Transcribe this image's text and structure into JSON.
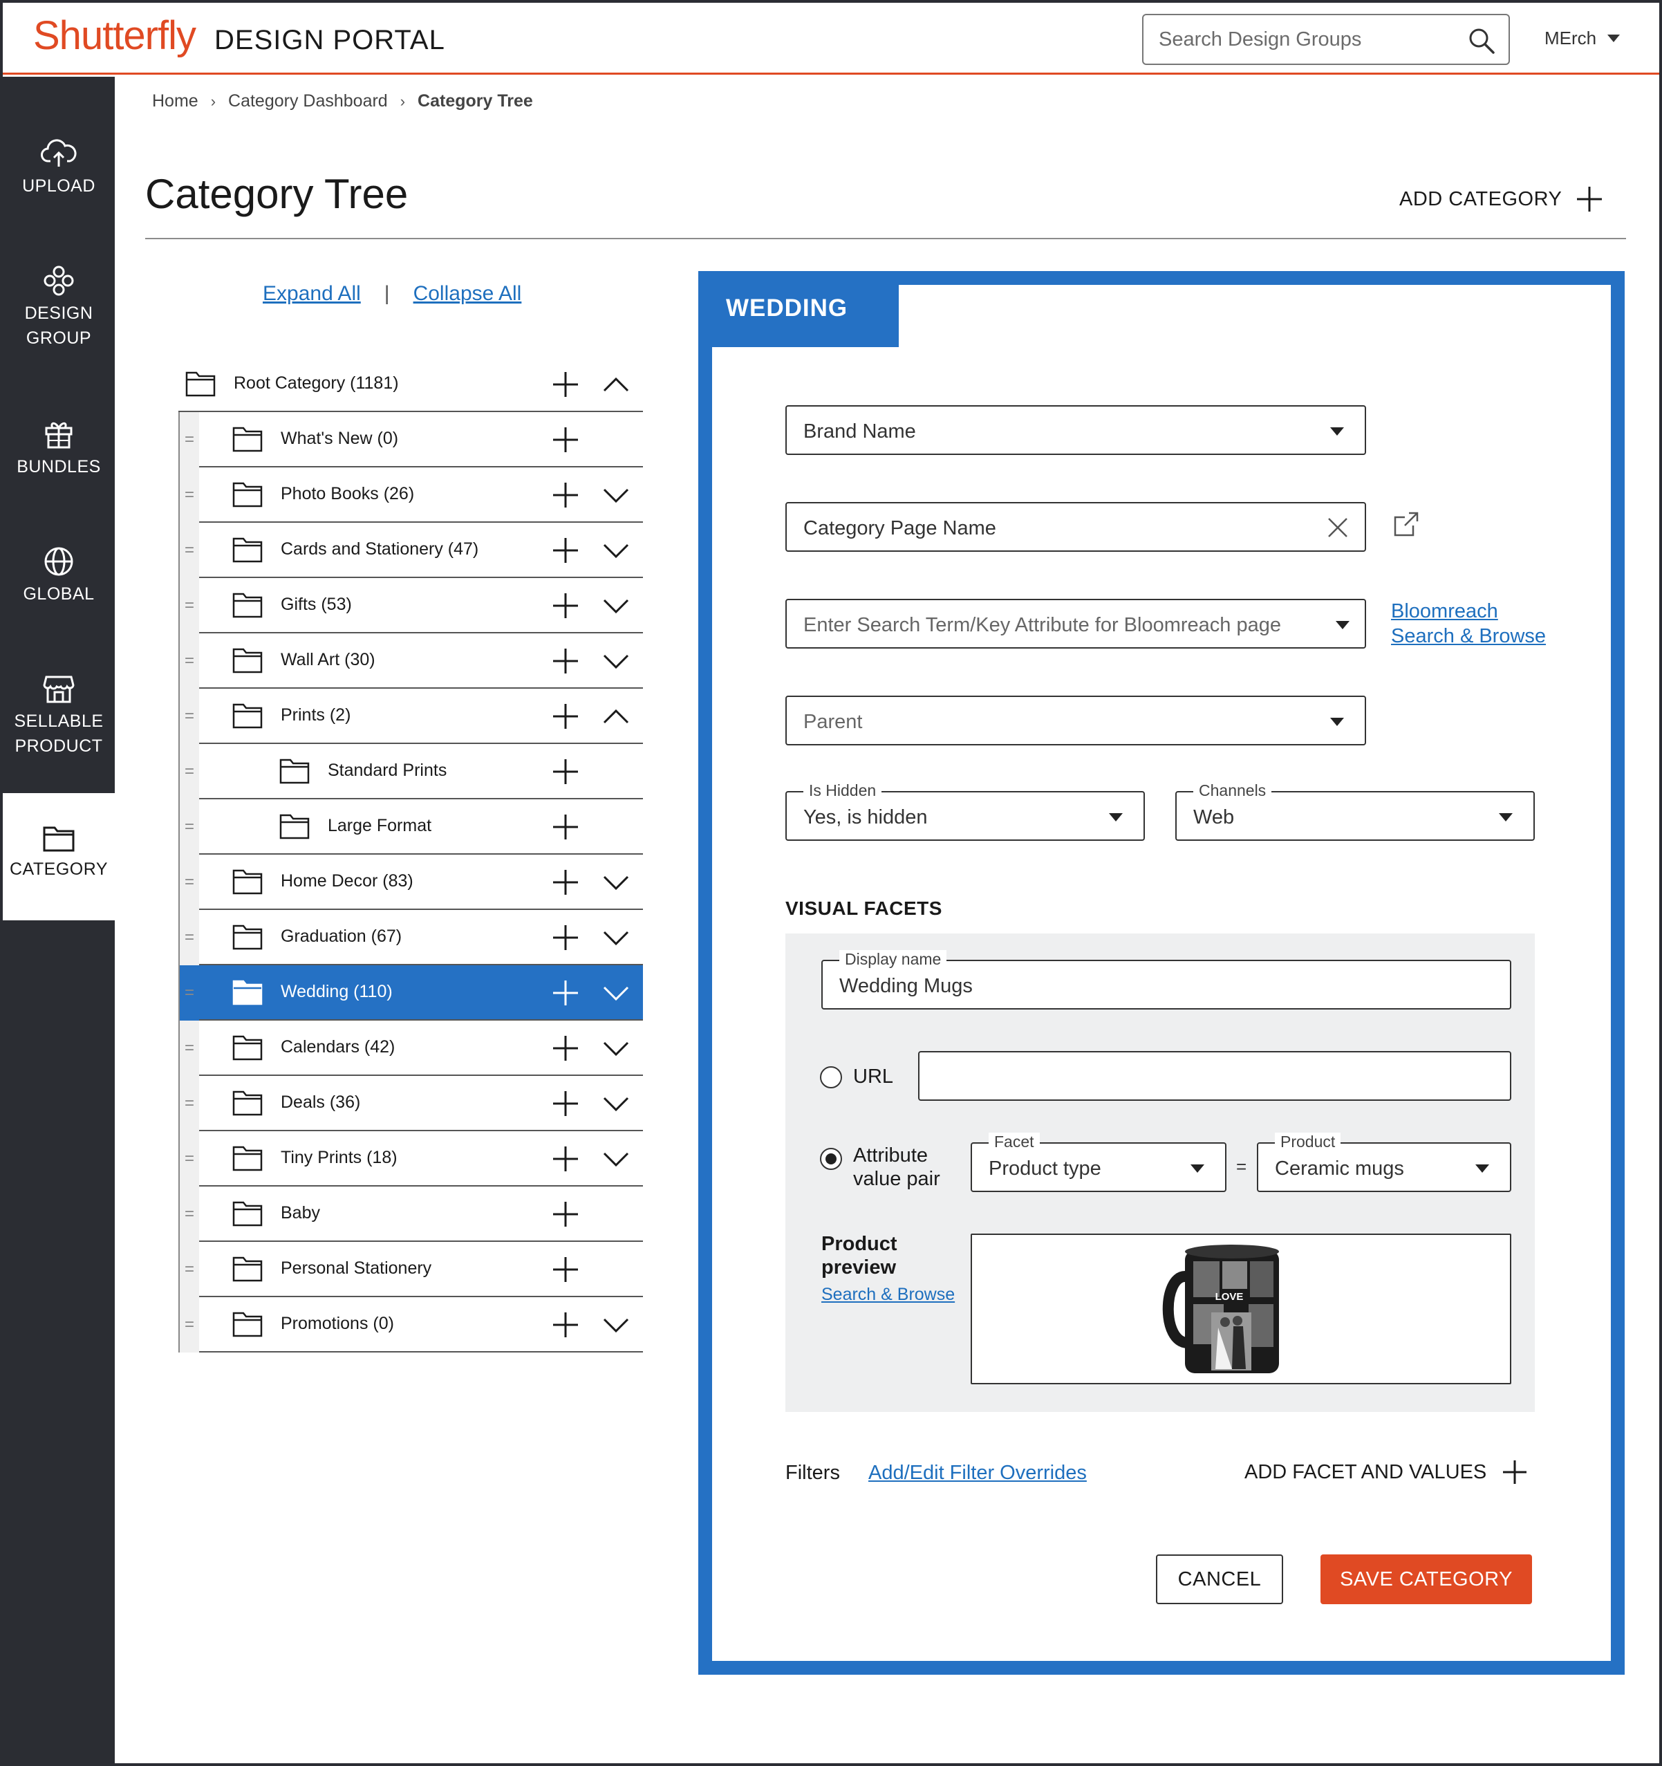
{
  "header": {
    "logo": "Shutterfly",
    "portal_title": "DESIGN PORTAL",
    "search_placeholder": "Search Design Groups",
    "user": "MErch",
    "accent_color": "#e04a23"
  },
  "sidebar": {
    "items": [
      {
        "label": "UPLOAD",
        "icon": "upload-cloud-icon"
      },
      {
        "label_line1": "DESIGN",
        "label_line2": "GROUP",
        "icon": "design-group-icon"
      },
      {
        "label": "BUNDLES",
        "icon": "gift-bundle-icon"
      },
      {
        "label": "GLOBAL",
        "icon": "globe-icon"
      },
      {
        "label_line1": "SELLABLE",
        "label_line2": "PRODUCT",
        "icon": "storefront-icon"
      },
      {
        "label": "CATEGORY",
        "icon": "folder-icon",
        "active": true
      }
    ]
  },
  "breadcrumb": {
    "home": "Home",
    "dashboard": "Category Dashboard",
    "current": "Category Tree",
    "separator": "›"
  },
  "page": {
    "title": "Category Tree",
    "add_category": "ADD CATEGORY"
  },
  "tree_controls": {
    "expand_all": "Expand All",
    "separator": "|",
    "collapse_all": "Collapse All"
  },
  "tree": {
    "root": "Root Category (1181)",
    "rows": [
      {
        "label": "What's New (0)",
        "level": 1,
        "chevron": "none"
      },
      {
        "label": "Photo Books (26)",
        "level": 1,
        "chevron": "down"
      },
      {
        "label": "Cards and Stationery (47)",
        "level": 1,
        "chevron": "down"
      },
      {
        "label": "Gifts (53)",
        "level": 1,
        "chevron": "down"
      },
      {
        "label": "Wall Art (30)",
        "level": 1,
        "chevron": "down"
      },
      {
        "label": "Prints (2)",
        "level": 1,
        "chevron": "up"
      },
      {
        "label": "Standard Prints",
        "level": 2,
        "chevron": "none"
      },
      {
        "label": "Large Format",
        "level": 2,
        "chevron": "none"
      },
      {
        "label": "Home Decor (83)",
        "level": 1,
        "chevron": "down"
      },
      {
        "label": "Graduation (67)",
        "level": 1,
        "chevron": "down"
      },
      {
        "label": "Wedding (110)",
        "level": 1,
        "chevron": "down",
        "selected": true
      },
      {
        "label": "Calendars (42)",
        "level": 1,
        "chevron": "down"
      },
      {
        "label": "Deals (36)",
        "level": 1,
        "chevron": "down"
      },
      {
        "label": "Tiny Prints (18)",
        "level": 1,
        "chevron": "down"
      },
      {
        "label": "Baby",
        "level": 1,
        "chevron": "none"
      },
      {
        "label": "Personal Stationery",
        "level": 1,
        "chevron": "none"
      },
      {
        "label": "Promotions (0)",
        "level": 1,
        "chevron": "down"
      }
    ],
    "selected_color": "#2571c4"
  },
  "form": {
    "tab_title": "WEDDING",
    "brand_name": "Brand Name",
    "category_page_name": "Category Page Name",
    "search_term_placeholder": "Enter Search Term/Key Attribute for Bloomreach page",
    "bloomreach_link_line1": "Bloomreach",
    "bloomreach_link_line2": "Search & Browse",
    "parent_placeholder": "Parent",
    "is_hidden_label": "Is Hidden",
    "is_hidden_value": "Yes, is hidden",
    "channels_label": "Channels",
    "channels_value": "Web",
    "visual_facets_heading": "VISUAL FACETS",
    "display_name_label": "Display name",
    "display_name_value": "Wedding Mugs",
    "url_label": "URL",
    "url_value": "",
    "attribute_label_line1": "Attribute",
    "attribute_label_line2": "value pair",
    "facet_label": "Facet",
    "facet_value": "Product type",
    "equals": "=",
    "product_label": "Product",
    "product_value": "Ceramic mugs",
    "preview_label_line1": "Product",
    "preview_label_line2": "preview",
    "preview_link": "Search & Browse",
    "mug_text": "LOVE",
    "filters_label": "Filters",
    "filters_link": "Add/Edit Filter Overrides",
    "add_facet": "ADD FACET AND VALUES",
    "cancel": "CANCEL",
    "save": "SAVE CATEGORY"
  }
}
